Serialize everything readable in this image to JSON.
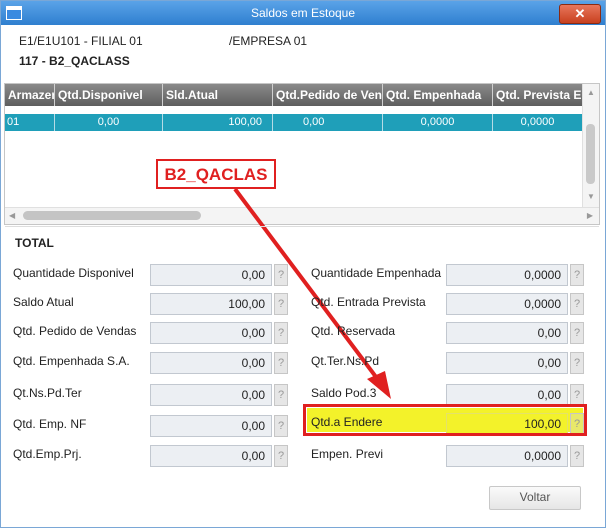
{
  "window": {
    "title": "Saldos em Estoque",
    "close_label": "✕"
  },
  "header": {
    "company_line": "E1/E1U101 - FILIAL 01",
    "empresa": "/EMPRESA 01",
    "product": "117 - B2_QACLASS"
  },
  "grid": {
    "columns": [
      "Armazem",
      "Qtd.Disponivel",
      "Sld.Atual",
      "Qtd.Pedido de Vendas",
      "Qtd. Empenhada",
      "Qtd. Prevista Ent"
    ],
    "rows": [
      [
        "01",
        "0,00",
        "100,00",
        "0,00",
        "0,0000",
        "0,0000"
      ]
    ]
  },
  "annotation": {
    "label": "B2_QACLAS",
    "color": "#e02020"
  },
  "total": {
    "heading": "TOTAL",
    "left": [
      {
        "label": "Quantidade Disponivel",
        "value": "0,00"
      },
      {
        "label": "Saldo Atual",
        "value": "100,00"
      },
      {
        "label": "Qtd. Pedido de Vendas",
        "value": "0,00"
      },
      {
        "label": "Qtd. Empenhada S.A.",
        "value": "0,00"
      },
      {
        "label": "Qt.Ns.Pd.Ter",
        "value": "0,00"
      },
      {
        "label": "Qtd. Emp. NF",
        "value": "0,00"
      },
      {
        "label": "Qtd.Emp.Prj.",
        "value": "0,00"
      }
    ],
    "right": [
      {
        "label": "Quantidade Empenhada",
        "value": "0,0000"
      },
      {
        "label": "Qtd. Entrada Prevista",
        "value": "0,0000"
      },
      {
        "label": "Qtd. Reservada",
        "value": "0,00"
      },
      {
        "label": "Qt.Ter.Ns.Pd",
        "value": "0,00"
      },
      {
        "label": "Saldo Pod.3",
        "value": "0,00"
      },
      {
        "label": "Qtd.a Endere",
        "value": "100,00"
      },
      {
        "label": "Empen. Previ",
        "value": "0,0000"
      }
    ],
    "help_label": "?"
  },
  "buttons": {
    "voltar": "Voltar"
  },
  "colors": {
    "titlebar": "#2f7fcf",
    "row_selected": "#1f9fb9",
    "highlight": "#f3f22a"
  }
}
